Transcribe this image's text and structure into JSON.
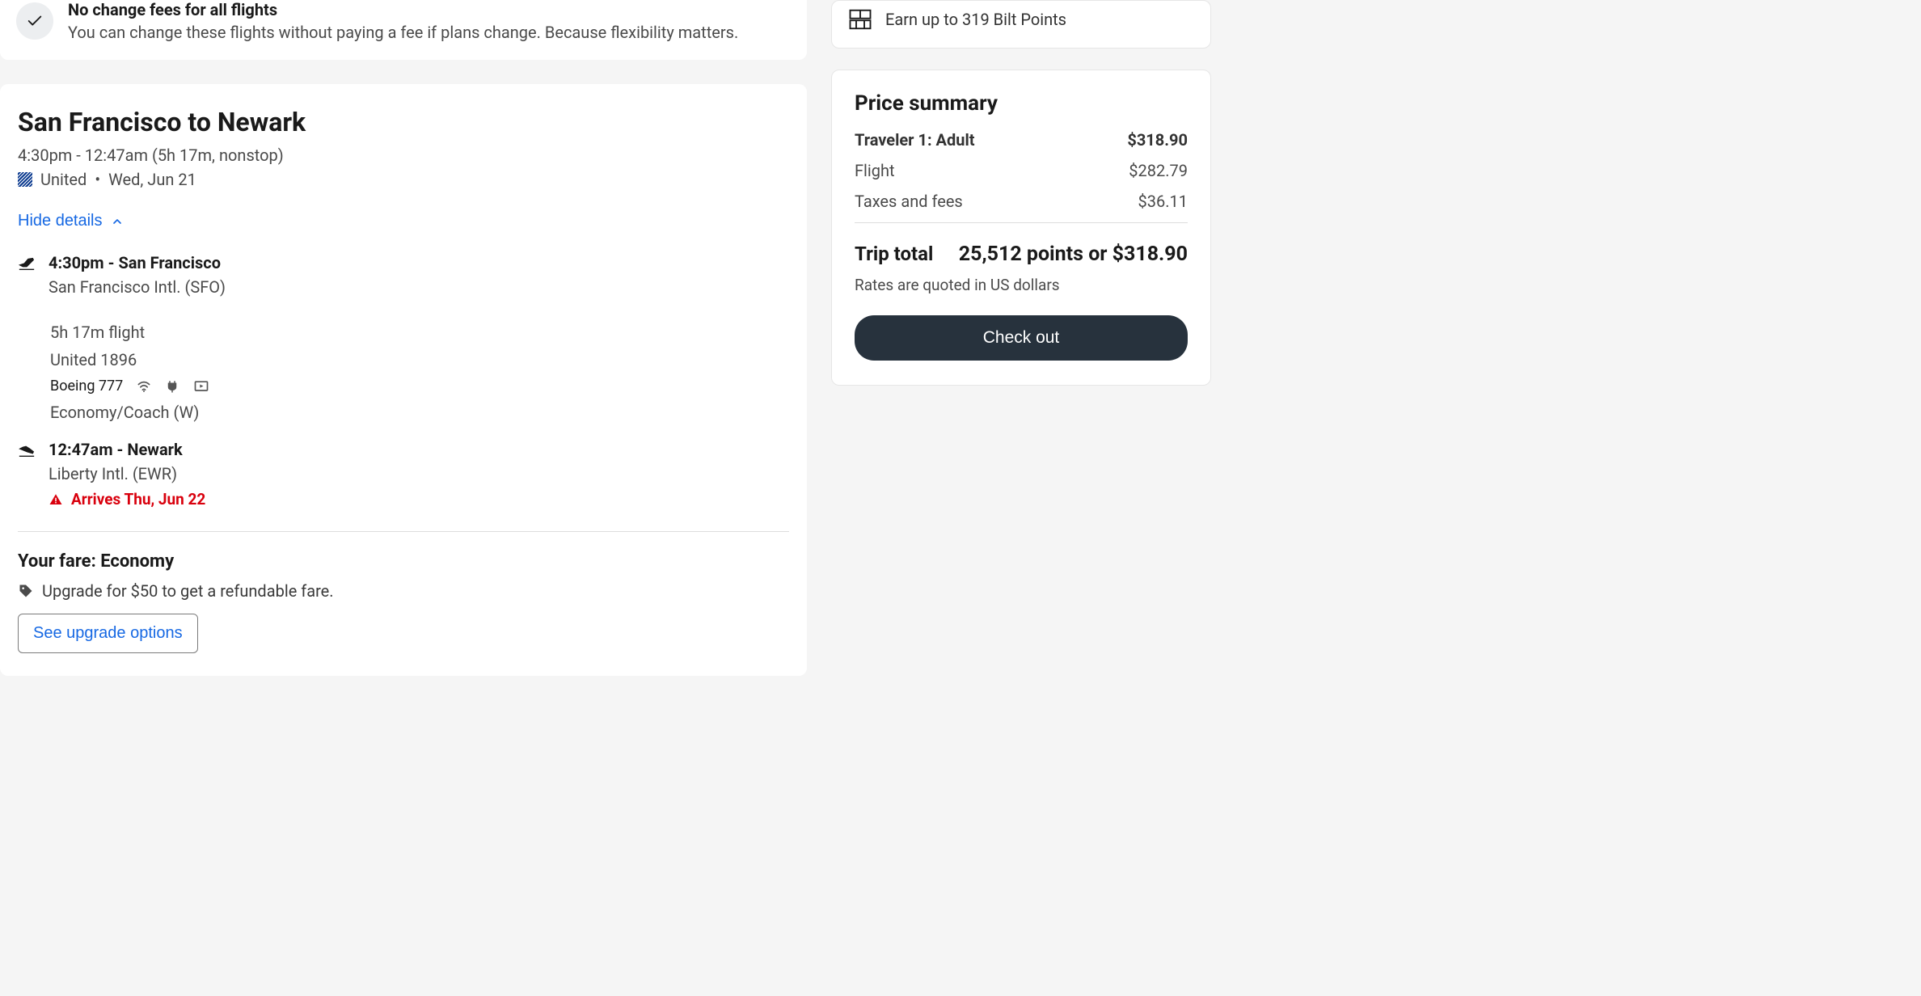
{
  "banner": {
    "title": "No change fees for all flights",
    "subtitle": "You can change these flights without paying a fee if plans change. Because flexibility matters."
  },
  "flight": {
    "route_title": "San Francisco to Newark",
    "time_summary": "4:30pm - 12:47am (5h 17m, nonstop)",
    "airline": "United",
    "date": "Wed, Jun 21",
    "hide_details_label": "Hide details",
    "departure": {
      "time_city": "4:30pm - San Francisco",
      "airport": "San Francisco Intl. (SFO)"
    },
    "duration": "5h 17m flight",
    "flight_number": "United 1896",
    "aircraft": "Boeing 777",
    "cabin": "Economy/Coach (W)",
    "arrival": {
      "time_city": "12:47am - Newark",
      "airport": "Liberty Intl. (EWR)",
      "warning": "Arrives Thu, Jun 22"
    }
  },
  "fare": {
    "title": "Your fare: Economy",
    "upgrade_text": "Upgrade for $50 to get a refundable fare.",
    "upgrade_button": "See upgrade options"
  },
  "bilt": {
    "text": "Earn up to 319 Bilt Points"
  },
  "price_summary": {
    "title": "Price summary",
    "traveler_label": "Traveler 1: Adult",
    "traveler_value": "$318.90",
    "flight_label": "Flight",
    "flight_value": "$282.79",
    "taxes_label": "Taxes and fees",
    "taxes_value": "$36.11",
    "trip_total_label": "Trip total",
    "trip_total_value": "25,512 points or $318.90",
    "rates_note": "Rates are quoted in US dollars",
    "checkout_label": "Check out"
  }
}
